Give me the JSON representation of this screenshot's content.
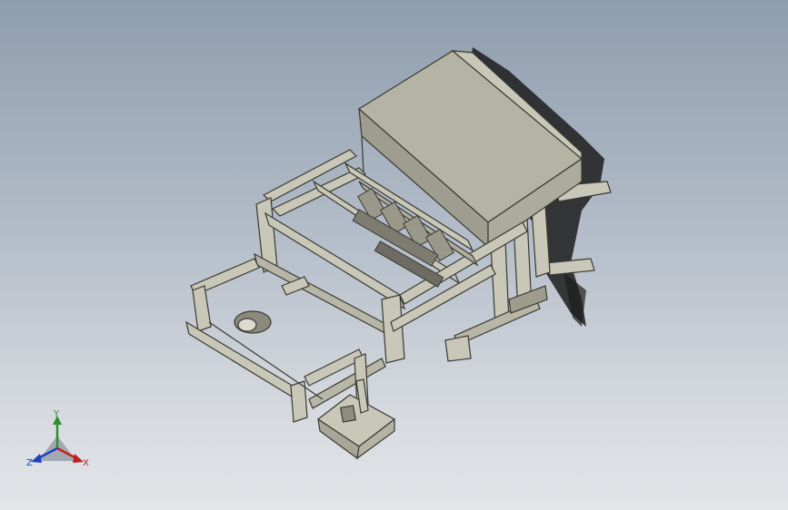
{
  "viewport": {
    "background_top": "#8e9dae",
    "background_bottom": "#e3e5e8",
    "model_color": "#c9c7b8",
    "model_edge_color": "#3a3a34",
    "shadow_color": "#1c1c1c"
  },
  "triad": {
    "labels": {
      "y": "Y",
      "x": "X",
      "z": "Z"
    },
    "colors": {
      "y": "#2f8f2f",
      "x": "#c02020",
      "z": "#2040c0"
    }
  }
}
